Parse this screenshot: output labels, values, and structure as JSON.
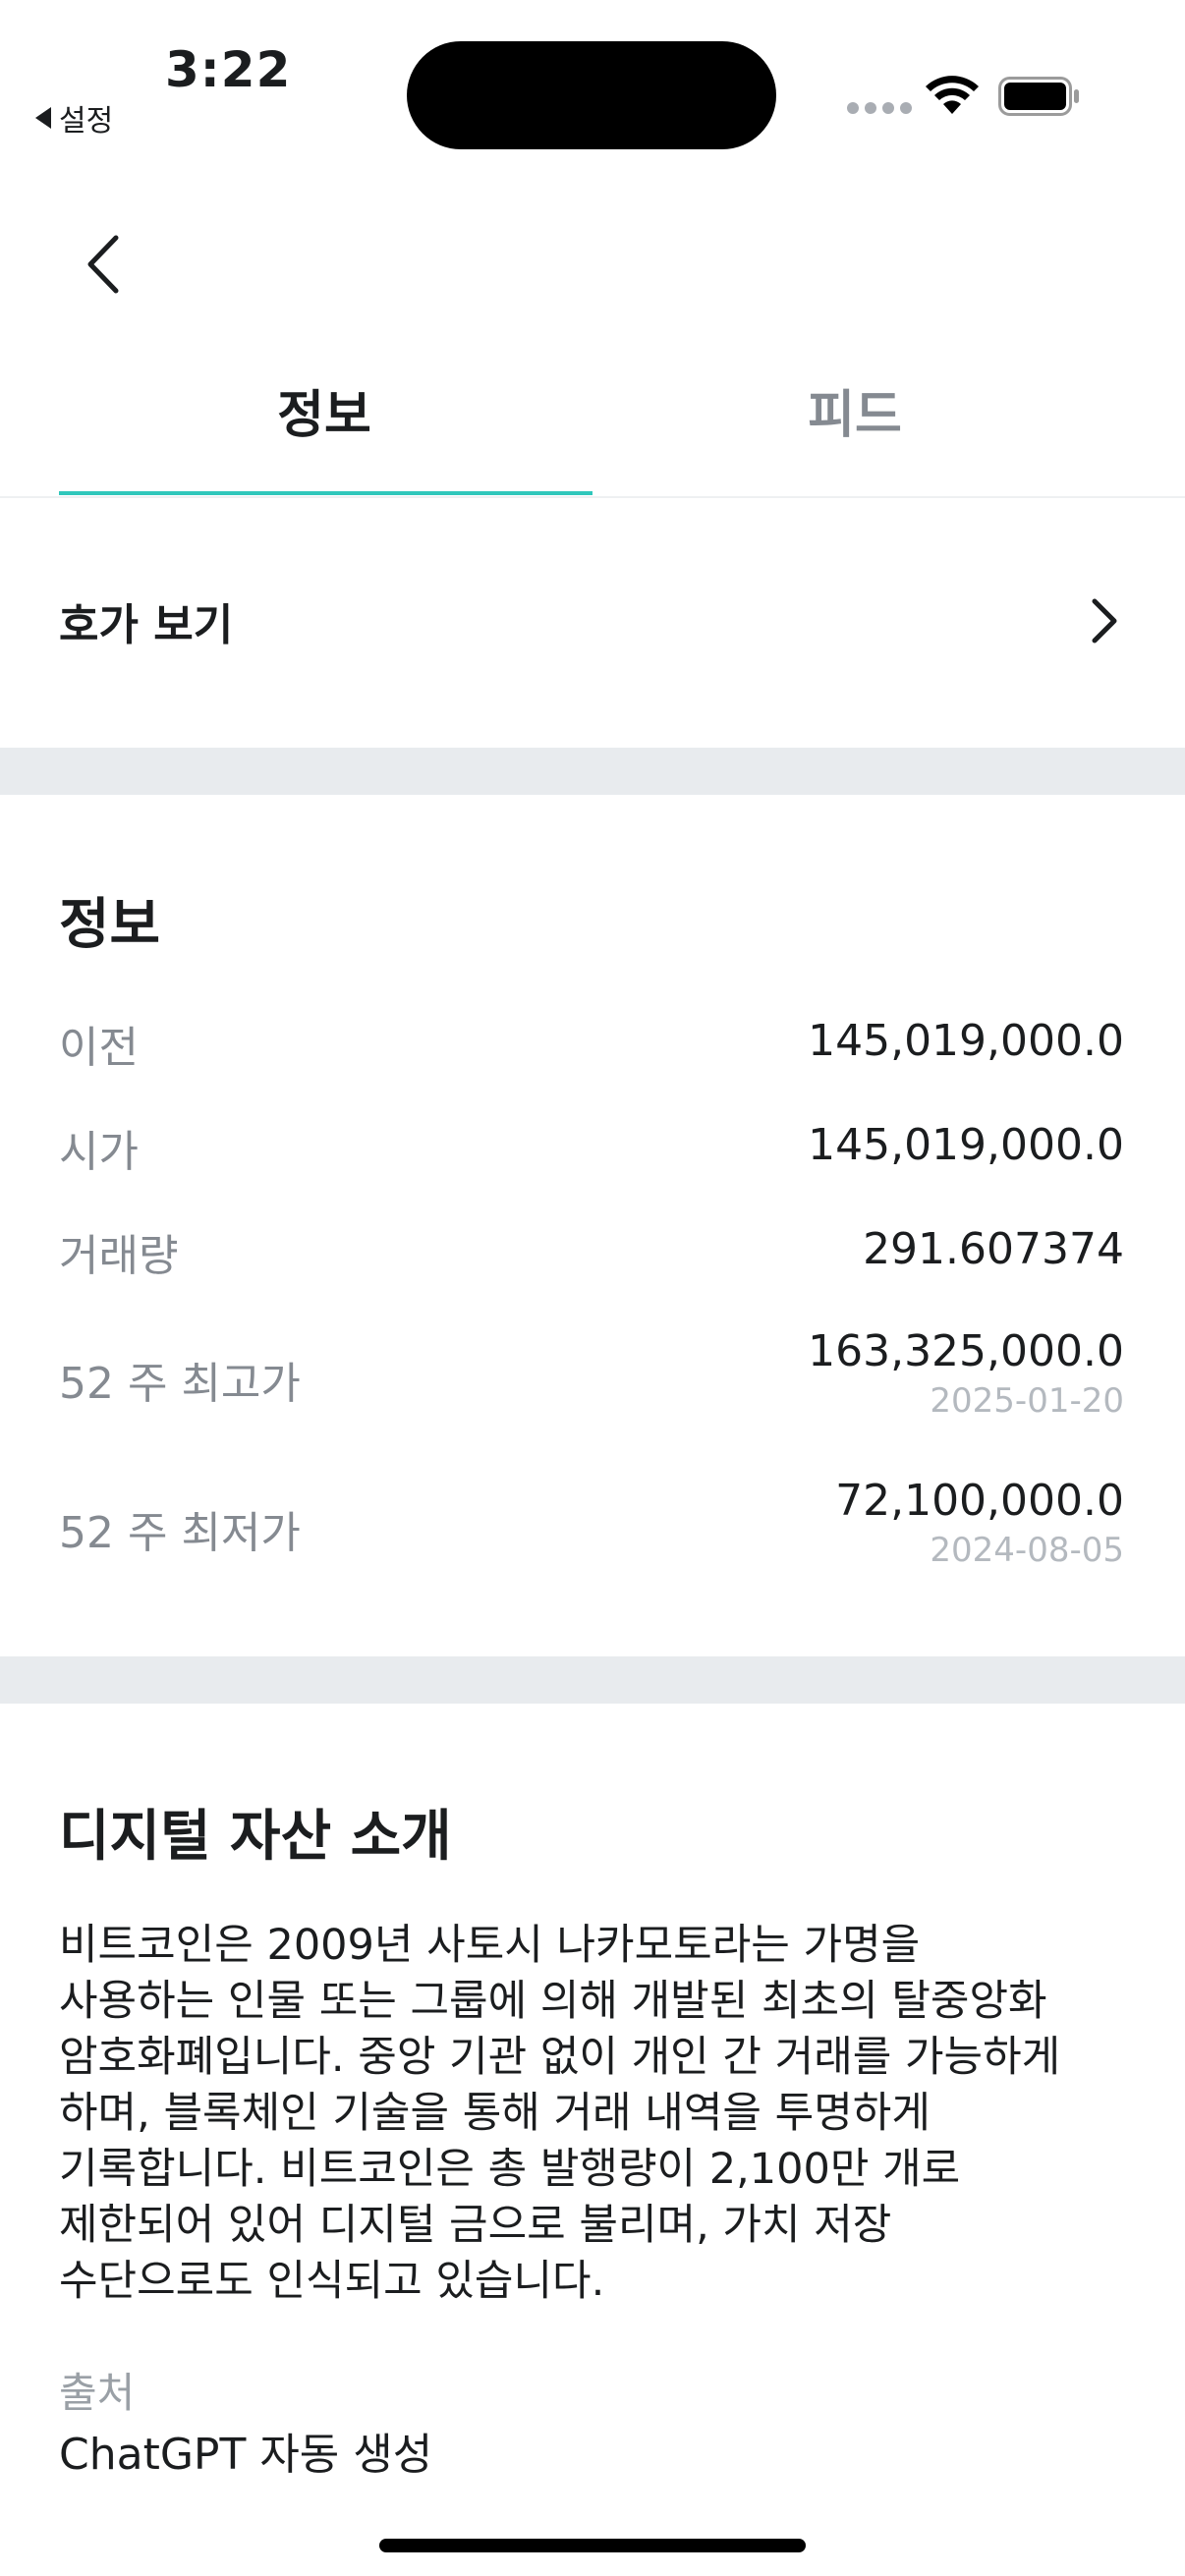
{
  "status_bar": {
    "time": "3:22",
    "back_app": "설정"
  },
  "tabs": [
    {
      "label": "정보",
      "active": true
    },
    {
      "label": "피드",
      "active": false
    }
  ],
  "orderbook": {
    "label": "호가 보기"
  },
  "info": {
    "title": "정보",
    "rows": [
      {
        "label": "이전",
        "value": "145,019,000.0"
      },
      {
        "label": "시가",
        "value": "145,019,000.0"
      },
      {
        "label": "거래량",
        "value": "291.607374"
      },
      {
        "label": "52 주 최고가",
        "value": "163,325,000.0",
        "date": "2025-01-20"
      },
      {
        "label": "52 주 최저가",
        "value": "72,100,000.0",
        "date": "2024-08-05"
      }
    ]
  },
  "intro": {
    "title": "디지털 자산 소개",
    "lines": [
      "비트코인은 2009년 사토시 나카모토라는 가명을",
      "사용하는 인물 또는 그룹에 의해 개발된 최초의 탈중앙화",
      "암호화폐입니다. 중앙 기관 없이 개인 간 거래를 가능하게",
      "하며, 블록체인 기술을 통해 거래 내역을 투명하게",
      "기록합니다. 비트코인은 총 발행량이 2,100만 개로",
      "제한되어 있어 디지털 금으로 불리며, 가치 저장",
      "수단으로도 인식되고 있습니다."
    ],
    "source_label": "출처",
    "source_value": "ChatGPT 자동 생성"
  },
  "colors": {
    "accent": "#2fc7bb",
    "text": "#1b1d1f",
    "muted": "#858a91",
    "section_gap": "#e8ebee"
  }
}
